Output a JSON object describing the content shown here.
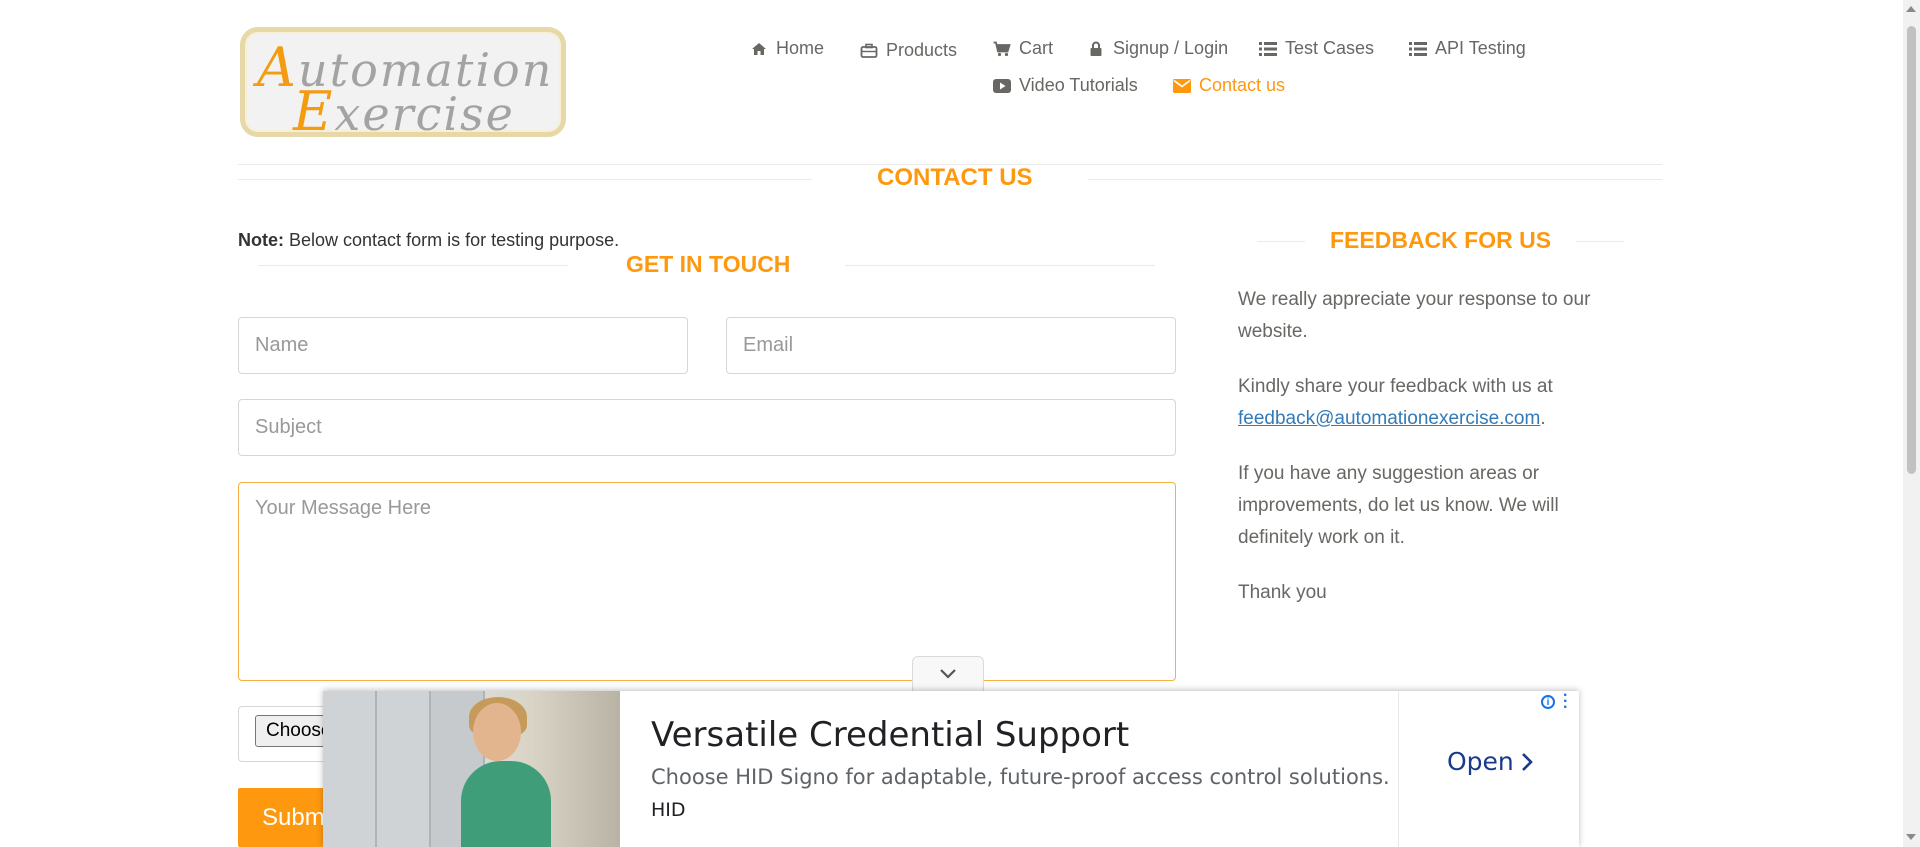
{
  "logo": {
    "line1_cap": "A",
    "line1_rest": "utomation",
    "line2_cap": "E",
    "line2_rest": "xercise"
  },
  "nav": {
    "items": [
      {
        "label": "Home",
        "icon": "home-icon"
      },
      {
        "label": "Products",
        "icon": "briefcase-icon"
      },
      {
        "label": "Cart",
        "icon": "cart-icon"
      },
      {
        "label": "Signup / Login",
        "icon": "lock-icon"
      },
      {
        "label": "Test Cases",
        "icon": "list-icon"
      },
      {
        "label": "API Testing",
        "icon": "list-icon"
      },
      {
        "label": "Video Tutorials",
        "icon": "youtube-icon"
      },
      {
        "label": "Contact us",
        "icon": "envelope-icon",
        "active": true
      }
    ]
  },
  "page": {
    "title": "CONTACT US"
  },
  "form": {
    "note_bold": "Note:",
    "note_text": " Below contact form is for testing purpose.",
    "title": "GET IN TOUCH",
    "name_placeholder": "Name",
    "email_placeholder": "Email",
    "subject_placeholder": "Subject",
    "message_placeholder": "Your Message Here",
    "file_button": "Choose",
    "submit_label": "Subm"
  },
  "feedback": {
    "title": "FEEDBACK FOR US",
    "p1": "We really appreciate your response to our website.",
    "p2_text": "Kindly share your feedback with us at ",
    "p2_email": "feedback@automationexercise.com",
    "p2_end": ".",
    "p3": "If you have any suggestion areas or improvements, do let us know. We will definitely work on it.",
    "p4": "Thank you"
  },
  "ad": {
    "title": "Versatile Credential Support",
    "description": "Choose HID Signo for adaptable, future-proof access control solutions.",
    "brand": "HID",
    "cta": "Open"
  },
  "colors": {
    "accent": "#fe980f",
    "text": "#696763",
    "link": "#337ab7"
  }
}
